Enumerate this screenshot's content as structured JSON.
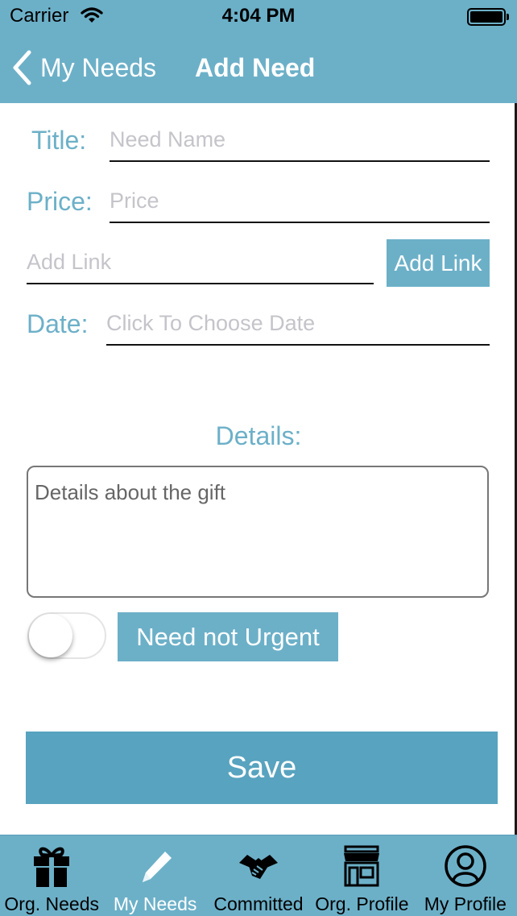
{
  "status": {
    "carrier": "Carrier",
    "time": "4:04 PM"
  },
  "nav": {
    "back_label": "My Needs",
    "title": "Add Need"
  },
  "form": {
    "title_label": "Title:",
    "title_placeholder": "Need Name",
    "price_label": "Price:",
    "price_placeholder": "Price",
    "link_placeholder": "Add Link",
    "add_link_button": "Add Link",
    "date_label": "Date:",
    "date_placeholder": "Click To Choose Date",
    "details_label": "Details:",
    "details_value": "Details about the gift",
    "urgent_toggle_on": false,
    "urgent_button": "Need not Urgent",
    "save_button": "Save"
  },
  "tabs": [
    {
      "label": "Org. Needs",
      "icon": "gift-icon",
      "active": false
    },
    {
      "label": "My Needs",
      "icon": "pencil-icon",
      "active": true
    },
    {
      "label": "Committed",
      "icon": "handshake-icon",
      "active": false
    },
    {
      "label": "Org. Profile",
      "icon": "storefront-icon",
      "active": false
    },
    {
      "label": "My Profile",
      "icon": "user-circle-icon",
      "active": false
    }
  ],
  "colors": {
    "accent": "#6cb0c8",
    "save": "#58a3bf"
  }
}
